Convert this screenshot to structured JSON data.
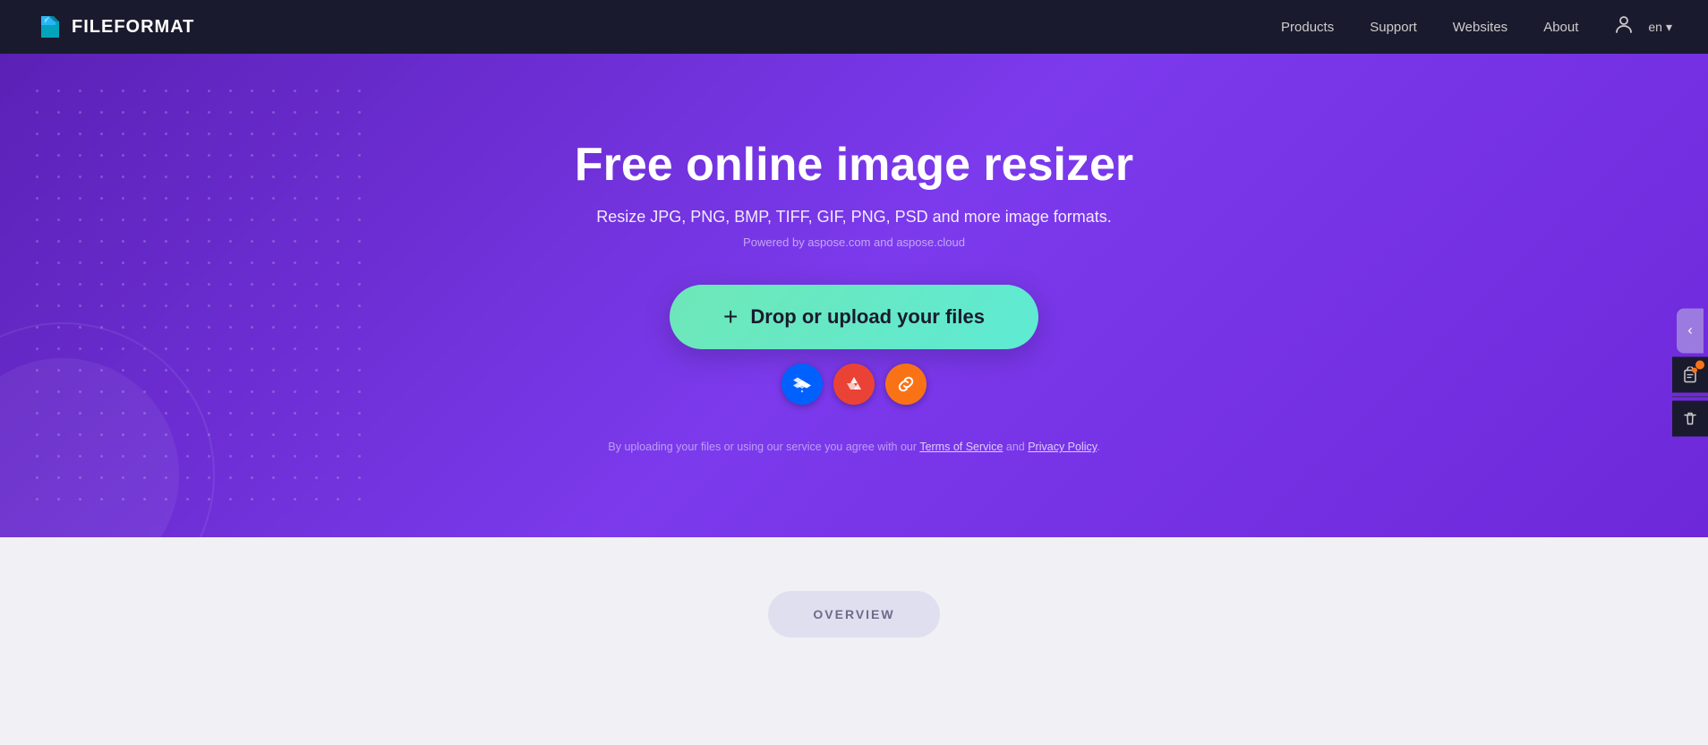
{
  "navbar": {
    "logo_text": "FILEFORMAT",
    "nav_items": [
      {
        "label": "Products",
        "id": "products"
      },
      {
        "label": "Support",
        "id": "support"
      },
      {
        "label": "Websites",
        "id": "websites"
      },
      {
        "label": "About",
        "id": "about"
      }
    ],
    "lang": "en",
    "lang_chevron": "▾"
  },
  "hero": {
    "title": "Free online image resizer",
    "subtitle": "Resize JPG, PNG, BMP, TIFF, GIF, PNG, PSD and more image formats.",
    "powered_by": "Powered by aspose.com and aspose.cloud",
    "upload_button_label": "Drop or upload your files",
    "upload_plus_icon": "+",
    "sources": [
      {
        "id": "dropbox",
        "label": "D",
        "title": "Upload from Dropbox"
      },
      {
        "id": "google-drive",
        "label": "G",
        "title": "Upload from Google Drive"
      },
      {
        "id": "url",
        "label": "🔗",
        "title": "Upload from URL"
      }
    ],
    "terms_text_before": "By uploading your files or using our service you agree with our ",
    "terms_of_service": "Terms of Service",
    "terms_and": " and ",
    "privacy_policy": "Privacy Policy",
    "terms_period": "."
  },
  "below_hero": {
    "overview_label": "OVERVIEW"
  },
  "floating_sidebar": {
    "toggle_icon": "‹",
    "clipboard_icon": "📋",
    "divider": "",
    "trash_icon": "🗑"
  }
}
